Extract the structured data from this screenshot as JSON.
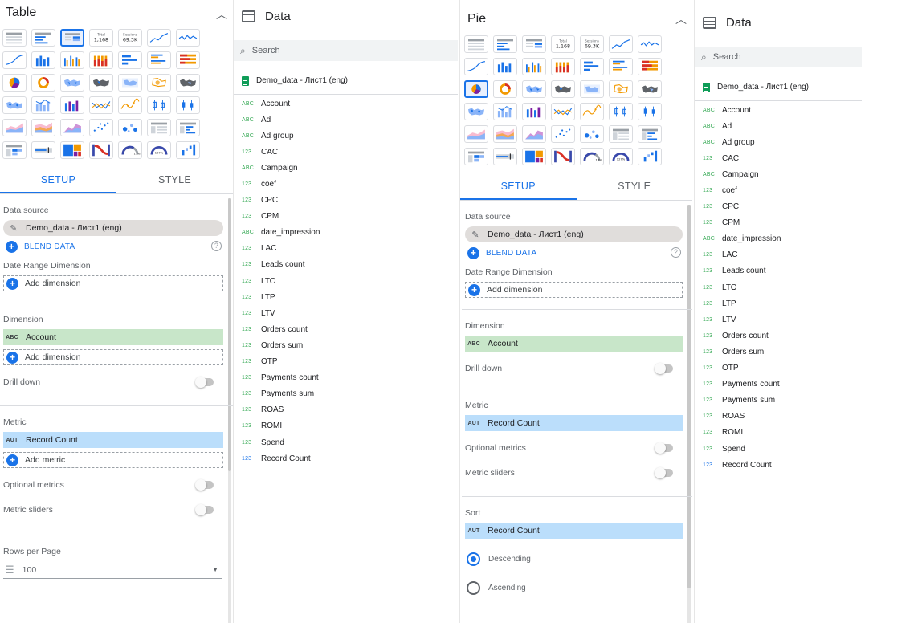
{
  "left": {
    "title": "Table",
    "tabs": [
      "SETUP",
      "STYLE"
    ],
    "data_source_label": "Data source",
    "data_source_name": "Demo_data - Лист1 (eng)",
    "blend_label": "BLEND DATA",
    "date_range_label": "Date Range Dimension",
    "add_dimension": "Add dimension",
    "dimension_label": "Dimension",
    "dimension_field": "Account",
    "dimension_tag": "ABC",
    "add_dimension2": "Add dimension",
    "drill_down": "Drill down",
    "metric_label": "Metric",
    "metric_field": "Record Count",
    "metric_tag": "AUT",
    "add_metric": "Add metric",
    "optional_metrics": "Optional metrics",
    "metric_sliders": "Metric sliders",
    "rows_per_page_label": "Rows per Page",
    "rows_per_page_value": "100"
  },
  "chart_tiles": {
    "total_label": "Total",
    "total_value": "1,168",
    "sessions_label": "Sessions",
    "sessions_value": "69.3K"
  },
  "data1": {
    "title": "Data",
    "search_placeholder": "Search",
    "source": "Demo_data - Лист1 (eng)",
    "fields": [
      {
        "tag": "ABC",
        "name": "Account"
      },
      {
        "tag": "ABC",
        "name": "Ad"
      },
      {
        "tag": "ABC",
        "name": "Ad group"
      },
      {
        "tag": "123",
        "name": "CAC"
      },
      {
        "tag": "ABC",
        "name": "Campaign"
      },
      {
        "tag": "123",
        "name": "coef"
      },
      {
        "tag": "123",
        "name": "CPC"
      },
      {
        "tag": "123",
        "name": "CPM"
      },
      {
        "tag": "ABC",
        "name": "date_impression"
      },
      {
        "tag": "123",
        "name": "LAC"
      },
      {
        "tag": "123",
        "name": "Leads count"
      },
      {
        "tag": "123",
        "name": "LTO"
      },
      {
        "tag": "123",
        "name": "LTP"
      },
      {
        "tag": "123",
        "name": "LTV"
      },
      {
        "tag": "123",
        "name": "Orders count"
      },
      {
        "tag": "123",
        "name": "Orders sum"
      },
      {
        "tag": "123",
        "name": "OTP"
      },
      {
        "tag": "123",
        "name": "Payments count"
      },
      {
        "tag": "123",
        "name": "Payments sum"
      },
      {
        "tag": "123",
        "name": "ROAS"
      },
      {
        "tag": "123",
        "name": "ROMI"
      },
      {
        "tag": "123",
        "name": "Spend"
      },
      {
        "tag": "123",
        "name": "Record Count"
      }
    ]
  },
  "right": {
    "title": "Pie",
    "tabs": [
      "SETUP",
      "STYLE"
    ],
    "data_source_label": "Data source",
    "data_source_name": "Demo_data - Лист1 (eng)",
    "blend_label": "BLEND DATA",
    "date_range_label": "Date Range Dimension",
    "add_dimension": "Add dimension",
    "dimension_label": "Dimension",
    "dimension_field": "Account",
    "dimension_tag": "ABC",
    "drill_down": "Drill down",
    "metric_label": "Metric",
    "metric_field": "Record Count",
    "metric_tag": "AUT",
    "optional_metrics": "Optional metrics",
    "metric_sliders": "Metric sliders",
    "sort_label": "Sort",
    "sort_field": "Record Count",
    "sort_tag": "AUT",
    "descending": "Descending",
    "ascending": "Ascending"
  },
  "data2": {
    "title": "Data",
    "search_placeholder": "Search",
    "source": "Demo_data - Лист1 (eng)"
  },
  "colors": {
    "accent": "#1a73e8",
    "dimension_bg": "#c8e6c9",
    "metric_bg": "#bbdefb",
    "pill_bg": "#e0dddb"
  }
}
